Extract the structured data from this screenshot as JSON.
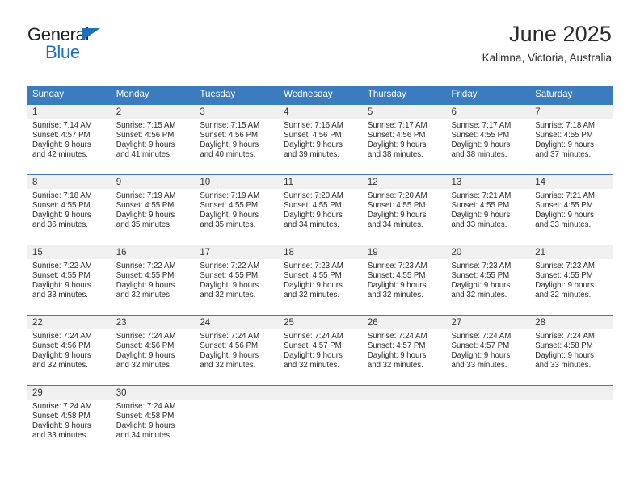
{
  "brand": {
    "name_line1": "General",
    "name_line2": "Blue",
    "triangle_color": "#1e6fba"
  },
  "header": {
    "month_title": "June 2025",
    "location": "Kalimna, Victoria, Australia"
  },
  "theme": {
    "header_blue": "#3a7cbe",
    "daynum_band": "#f0f0f0",
    "text": "#2a2a2a"
  },
  "weekday_headers": [
    "Sunday",
    "Monday",
    "Tuesday",
    "Wednesday",
    "Thursday",
    "Friday",
    "Saturday"
  ],
  "weeks": [
    [
      {
        "day": "1",
        "sunrise": "Sunrise: 7:14 AM",
        "sunset": "Sunset: 4:57 PM",
        "daylight_line1": "Daylight: 9 hours",
        "daylight_line2": "and 42 minutes."
      },
      {
        "day": "2",
        "sunrise": "Sunrise: 7:15 AM",
        "sunset": "Sunset: 4:56 PM",
        "daylight_line1": "Daylight: 9 hours",
        "daylight_line2": "and 41 minutes."
      },
      {
        "day": "3",
        "sunrise": "Sunrise: 7:15 AM",
        "sunset": "Sunset: 4:56 PM",
        "daylight_line1": "Daylight: 9 hours",
        "daylight_line2": "and 40 minutes."
      },
      {
        "day": "4",
        "sunrise": "Sunrise: 7:16 AM",
        "sunset": "Sunset: 4:56 PM",
        "daylight_line1": "Daylight: 9 hours",
        "daylight_line2": "and 39 minutes."
      },
      {
        "day": "5",
        "sunrise": "Sunrise: 7:17 AM",
        "sunset": "Sunset: 4:56 PM",
        "daylight_line1": "Daylight: 9 hours",
        "daylight_line2": "and 38 minutes."
      },
      {
        "day": "6",
        "sunrise": "Sunrise: 7:17 AM",
        "sunset": "Sunset: 4:55 PM",
        "daylight_line1": "Daylight: 9 hours",
        "daylight_line2": "and 38 minutes."
      },
      {
        "day": "7",
        "sunrise": "Sunrise: 7:18 AM",
        "sunset": "Sunset: 4:55 PM",
        "daylight_line1": "Daylight: 9 hours",
        "daylight_line2": "and 37 minutes."
      }
    ],
    [
      {
        "day": "8",
        "sunrise": "Sunrise: 7:18 AM",
        "sunset": "Sunset: 4:55 PM",
        "daylight_line1": "Daylight: 9 hours",
        "daylight_line2": "and 36 minutes."
      },
      {
        "day": "9",
        "sunrise": "Sunrise: 7:19 AM",
        "sunset": "Sunset: 4:55 PM",
        "daylight_line1": "Daylight: 9 hours",
        "daylight_line2": "and 35 minutes."
      },
      {
        "day": "10",
        "sunrise": "Sunrise: 7:19 AM",
        "sunset": "Sunset: 4:55 PM",
        "daylight_line1": "Daylight: 9 hours",
        "daylight_line2": "and 35 minutes."
      },
      {
        "day": "11",
        "sunrise": "Sunrise: 7:20 AM",
        "sunset": "Sunset: 4:55 PM",
        "daylight_line1": "Daylight: 9 hours",
        "daylight_line2": "and 34 minutes."
      },
      {
        "day": "12",
        "sunrise": "Sunrise: 7:20 AM",
        "sunset": "Sunset: 4:55 PM",
        "daylight_line1": "Daylight: 9 hours",
        "daylight_line2": "and 34 minutes."
      },
      {
        "day": "13",
        "sunrise": "Sunrise: 7:21 AM",
        "sunset": "Sunset: 4:55 PM",
        "daylight_line1": "Daylight: 9 hours",
        "daylight_line2": "and 33 minutes."
      },
      {
        "day": "14",
        "sunrise": "Sunrise: 7:21 AM",
        "sunset": "Sunset: 4:55 PM",
        "daylight_line1": "Daylight: 9 hours",
        "daylight_line2": "and 33 minutes."
      }
    ],
    [
      {
        "day": "15",
        "sunrise": "Sunrise: 7:22 AM",
        "sunset": "Sunset: 4:55 PM",
        "daylight_line1": "Daylight: 9 hours",
        "daylight_line2": "and 33 minutes."
      },
      {
        "day": "16",
        "sunrise": "Sunrise: 7:22 AM",
        "sunset": "Sunset: 4:55 PM",
        "daylight_line1": "Daylight: 9 hours",
        "daylight_line2": "and 32 minutes."
      },
      {
        "day": "17",
        "sunrise": "Sunrise: 7:22 AM",
        "sunset": "Sunset: 4:55 PM",
        "daylight_line1": "Daylight: 9 hours",
        "daylight_line2": "and 32 minutes."
      },
      {
        "day": "18",
        "sunrise": "Sunrise: 7:23 AM",
        "sunset": "Sunset: 4:55 PM",
        "daylight_line1": "Daylight: 9 hours",
        "daylight_line2": "and 32 minutes."
      },
      {
        "day": "19",
        "sunrise": "Sunrise: 7:23 AM",
        "sunset": "Sunset: 4:55 PM",
        "daylight_line1": "Daylight: 9 hours",
        "daylight_line2": "and 32 minutes."
      },
      {
        "day": "20",
        "sunrise": "Sunrise: 7:23 AM",
        "sunset": "Sunset: 4:55 PM",
        "daylight_line1": "Daylight: 9 hours",
        "daylight_line2": "and 32 minutes."
      },
      {
        "day": "21",
        "sunrise": "Sunrise: 7:23 AM",
        "sunset": "Sunset: 4:55 PM",
        "daylight_line1": "Daylight: 9 hours",
        "daylight_line2": "and 32 minutes."
      }
    ],
    [
      {
        "day": "22",
        "sunrise": "Sunrise: 7:24 AM",
        "sunset": "Sunset: 4:56 PM",
        "daylight_line1": "Daylight: 9 hours",
        "daylight_line2": "and 32 minutes."
      },
      {
        "day": "23",
        "sunrise": "Sunrise: 7:24 AM",
        "sunset": "Sunset: 4:56 PM",
        "daylight_line1": "Daylight: 9 hours",
        "daylight_line2": "and 32 minutes."
      },
      {
        "day": "24",
        "sunrise": "Sunrise: 7:24 AM",
        "sunset": "Sunset: 4:56 PM",
        "daylight_line1": "Daylight: 9 hours",
        "daylight_line2": "and 32 minutes."
      },
      {
        "day": "25",
        "sunrise": "Sunrise: 7:24 AM",
        "sunset": "Sunset: 4:57 PM",
        "daylight_line1": "Daylight: 9 hours",
        "daylight_line2": "and 32 minutes."
      },
      {
        "day": "26",
        "sunrise": "Sunrise: 7:24 AM",
        "sunset": "Sunset: 4:57 PM",
        "daylight_line1": "Daylight: 9 hours",
        "daylight_line2": "and 32 minutes."
      },
      {
        "day": "27",
        "sunrise": "Sunrise: 7:24 AM",
        "sunset": "Sunset: 4:57 PM",
        "daylight_line1": "Daylight: 9 hours",
        "daylight_line2": "and 33 minutes."
      },
      {
        "day": "28",
        "sunrise": "Sunrise: 7:24 AM",
        "sunset": "Sunset: 4:58 PM",
        "daylight_line1": "Daylight: 9 hours",
        "daylight_line2": "and 33 minutes."
      }
    ],
    [
      {
        "day": "29",
        "sunrise": "Sunrise: 7:24 AM",
        "sunset": "Sunset: 4:58 PM",
        "daylight_line1": "Daylight: 9 hours",
        "daylight_line2": "and 33 minutes."
      },
      {
        "day": "30",
        "sunrise": "Sunrise: 7:24 AM",
        "sunset": "Sunset: 4:58 PM",
        "daylight_line1": "Daylight: 9 hours",
        "daylight_line2": "and 34 minutes."
      },
      {
        "day": "",
        "sunrise": "",
        "sunset": "",
        "daylight_line1": "",
        "daylight_line2": ""
      },
      {
        "day": "",
        "sunrise": "",
        "sunset": "",
        "daylight_line1": "",
        "daylight_line2": ""
      },
      {
        "day": "",
        "sunrise": "",
        "sunset": "",
        "daylight_line1": "",
        "daylight_line2": ""
      },
      {
        "day": "",
        "sunrise": "",
        "sunset": "",
        "daylight_line1": "",
        "daylight_line2": ""
      },
      {
        "day": "",
        "sunrise": "",
        "sunset": "",
        "daylight_line1": "",
        "daylight_line2": ""
      }
    ]
  ]
}
